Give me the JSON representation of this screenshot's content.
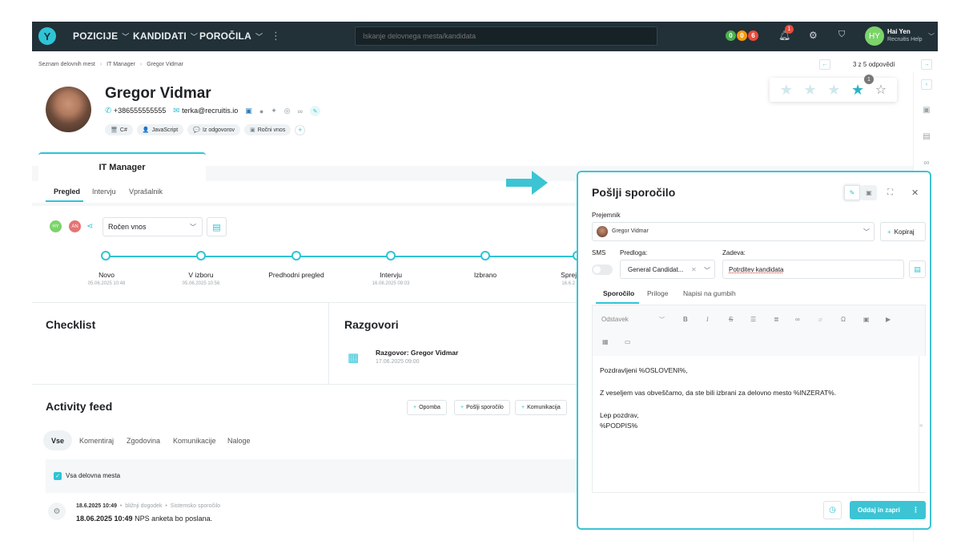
{
  "nav": {
    "logo": "Y",
    "items": [
      {
        "label": "POZICIJE"
      },
      {
        "label": "KANDIDATI"
      },
      {
        "label": "POROČILA"
      }
    ],
    "more": "⋮",
    "search_placeholder": "Iskanje delovnega mesta/kandidata",
    "status_dots": [
      {
        "count": "0",
        "color": "#4caf50"
      },
      {
        "count": "0",
        "color": "#f39c12"
      },
      {
        "count": "6",
        "color": "#e74c3c"
      }
    ],
    "notifications": "1",
    "user": {
      "initials": "HY",
      "name": "Hai Yen",
      "subtitle": "Recruitis Help"
    }
  },
  "breadcrumb": [
    "Seznam delovnih mest",
    "IT Manager",
    "Gregor Vidmar"
  ],
  "pagination": {
    "text": "3 z 5 odpovědí"
  },
  "candidate": {
    "name": "Gregor Vidmar",
    "phone": "+386555555555",
    "email": "terka@recruitis.io",
    "tags": [
      {
        "icon": "🖥",
        "label": "C#"
      },
      {
        "icon": "👤",
        "label": "JavaScript"
      },
      {
        "icon": "💬",
        "label": "Iz odgovorov"
      },
      {
        "icon": "▣",
        "label": "Ročni vnos"
      }
    ]
  },
  "rating": {
    "value": 4,
    "max": 5,
    "badge": "1"
  },
  "job": {
    "title": "IT Manager"
  },
  "tabs": [
    {
      "label": "Pregled"
    },
    {
      "label": "Intervju"
    },
    {
      "label": "Vprašalnik"
    }
  ],
  "stage": {
    "assignees": [
      {
        "initials": "HY",
        "color": "#7bd36a"
      },
      {
        "initials": "AN",
        "color": "#e57373"
      }
    ],
    "source": "Ročen vnos"
  },
  "pipeline": [
    {
      "label": "Novo",
      "date": "05.06.2025 10:48"
    },
    {
      "label": "V izboru",
      "date": "05.06.2025 10:56"
    },
    {
      "label": "Predhodni pregled",
      "date": ""
    },
    {
      "label": "Intervju",
      "date": "16.06.2025 09:03"
    },
    {
      "label": "Izbrano",
      "date": ""
    },
    {
      "label": "Sprej",
      "date": "16.6.2"
    }
  ],
  "checklist": {
    "title": "Checklist"
  },
  "conversations": {
    "title": "Razgovori",
    "items": [
      {
        "title": "Razgovor: Gregor Vidmar",
        "date": "17.06.2025 09:00"
      }
    ]
  },
  "activity": {
    "title": "Activity feed",
    "buttons": [
      {
        "label": "Opomba"
      },
      {
        "label": "Pošlji sporočilo"
      },
      {
        "label": "Komunikacija"
      }
    ],
    "tabs": [
      {
        "label": "Vse"
      },
      {
        "label": "Komentiraj"
      },
      {
        "label": "Zgodovina"
      },
      {
        "label": "Komunikacije"
      },
      {
        "label": "Naloge"
      }
    ],
    "filter": "Vsa delovna mesta",
    "entries": [
      {
        "time": "18.6.2025 10:49",
        "tag1": "bližnji dogodek",
        "tag2": "Sistemsko sporočilo",
        "text_bold": "18.06.2025 10:49",
        "text": "NPS anketa bo poslana."
      }
    ]
  },
  "modal": {
    "title": "Pošlji sporočilo",
    "recipient_label": "Prejemnik",
    "recipient": "Gregor Vidmar",
    "copy_label": "Kopiraj",
    "sms_label": "SMS",
    "template_label": "Predloga:",
    "template_value": "General Candidat...",
    "subject_label": "Zadeva:",
    "subject_value": "Potrditev kandidata",
    "tabs": [
      {
        "label": "Sporočilo"
      },
      {
        "label": "Priloge"
      },
      {
        "label": "Napisi na gumbih"
      }
    ],
    "paragraph_select": "Odstavek",
    "body": [
      "Pozdravljeni %OSLOVENI%,",
      "Z veseljem vas obveščamo, da ste bili izbrani za delovno mesto %INZERAT%.",
      "Lep pozdrav,",
      "%PODPIS%"
    ],
    "send_label": "Oddaj in zapri"
  },
  "colors": {
    "accent": "#2ec4d6",
    "nav_bg": "#223038"
  }
}
